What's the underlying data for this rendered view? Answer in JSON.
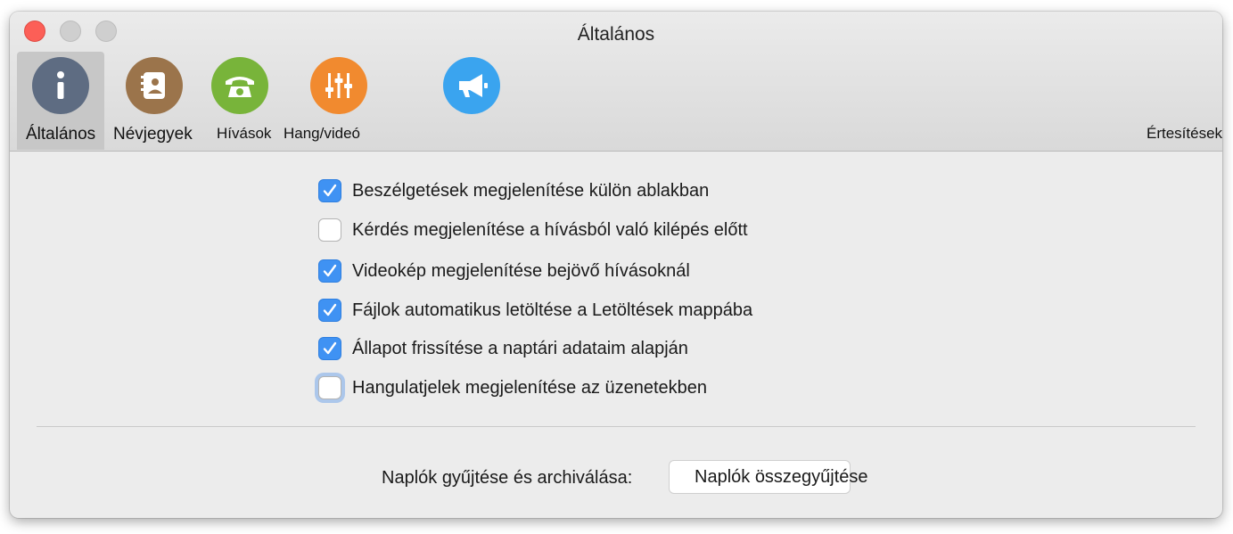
{
  "window": {
    "title": "Általános"
  },
  "tabs": [
    {
      "label": "Általános",
      "icon": "info-icon",
      "color": "#5e6c82",
      "selected": true
    },
    {
      "label": "Névjegyek",
      "icon": "contacts-icon",
      "color": "#9b744b",
      "selected": false
    },
    {
      "label": "Hívások",
      "icon": "phone-icon",
      "color": "#78b43a",
      "selected": false
    },
    {
      "label": "Hang/videó",
      "icon": "sliders-icon",
      "color": "#f18a2f",
      "selected": false
    },
    {
      "label": "Értesítések",
      "icon": "megaphone-icon",
      "color": "#3aa4ef",
      "selected": false
    }
  ],
  "options": [
    {
      "label": "Beszélgetések megjelenítése külön ablakban",
      "checked": true
    },
    {
      "label": "Kérdés megjelenítése a hívásból való kilépés előtt",
      "checked": false
    },
    {
      "label": "Videokép megjelenítése bejövő hívásoknál",
      "checked": true
    },
    {
      "label": "Fájlok automatikus letöltése a Letöltések mappába",
      "checked": true
    },
    {
      "label": "Állapot frissítése a naptári adataim alapján",
      "checked": true
    },
    {
      "label": "Hangulatjelek megjelenítése az üzenetekben",
      "checked": false,
      "focused": true
    }
  ],
  "logs": {
    "label": "Naplók gyűjtése és archiválása:",
    "button_label": "Naplók összegyűjtése"
  },
  "colors": {
    "accent": "#3f92f3",
    "close": "#fc5f57"
  }
}
